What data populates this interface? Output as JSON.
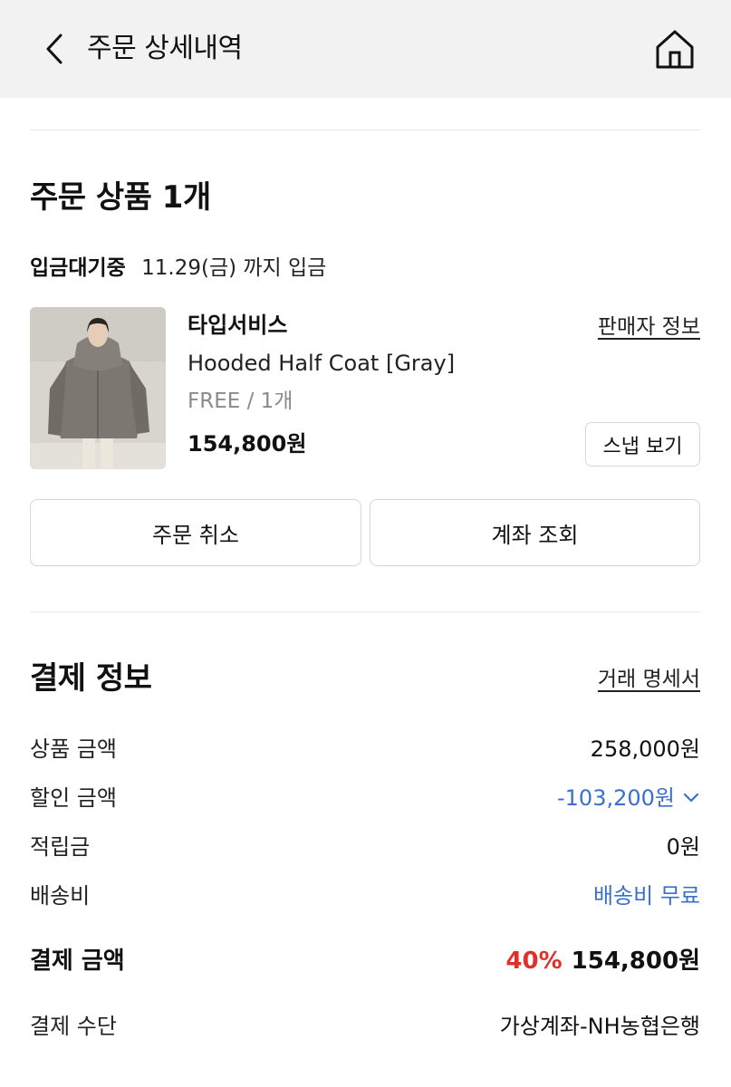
{
  "header": {
    "title": "주문 상세내역",
    "back_icon": "chevron-left-icon",
    "home_icon": "home-icon"
  },
  "order": {
    "section_title": "주문 상품 1개",
    "status": "입금대기중",
    "deadline": "11.29(금) 까지 입금",
    "product": {
      "brand": "타입서비스",
      "name": "Hooded Half Coat [Gray]",
      "option": "FREE / 1개",
      "price": "154,800원"
    },
    "seller_info_label": "판매자 정보",
    "snap_label": "스냅 보기",
    "cancel_label": "주문 취소",
    "account_label": "계좌 조회"
  },
  "payment": {
    "section_title": "결제 정보",
    "statement_label": "거래 명세서",
    "rows": [
      {
        "label": "상품 금액",
        "value": "258,000원"
      },
      {
        "label": "할인 금액",
        "value": "-103,200원"
      },
      {
        "label": "적립금",
        "value": "0원"
      },
      {
        "label": "배송비",
        "value": "배송비 무료"
      }
    ],
    "total_label": "결제 금액",
    "total_percent": "40%",
    "total_value": "154,800원",
    "method_label": "결제 수단",
    "method_value": "가상계좌-NH농협은행"
  },
  "colors": {
    "header_bg": "#f2f2f2",
    "accent_blue": "#3a6fd0",
    "discount_red": "#e0302a",
    "border": "#d6d6d6"
  }
}
